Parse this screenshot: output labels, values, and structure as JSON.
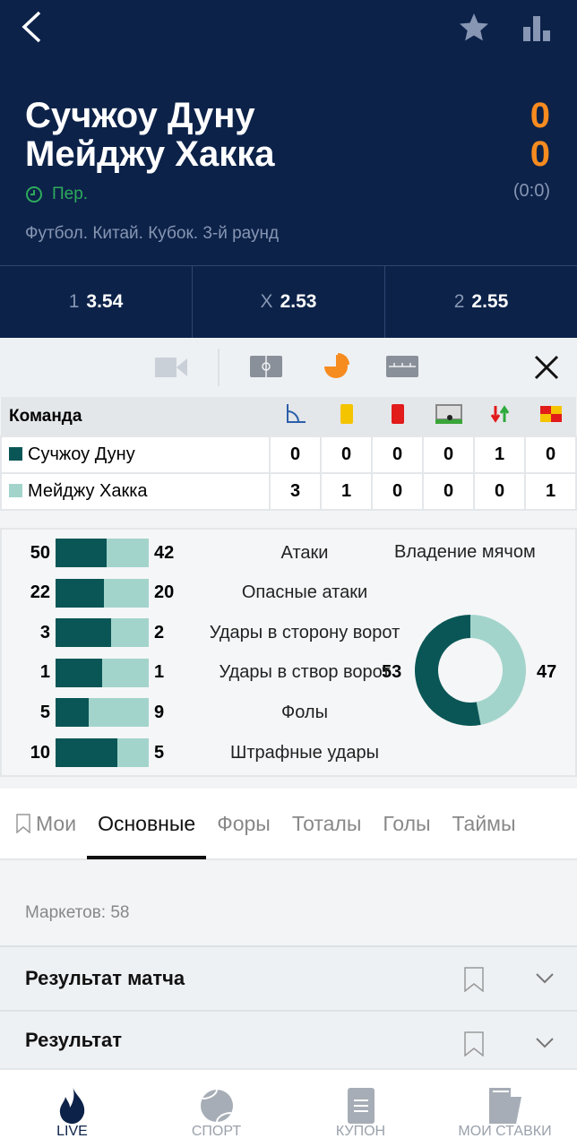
{
  "header": {
    "team1": "Сучжоу Дуну",
    "team2": "Мейджу Хакка",
    "score1": "0",
    "score2": "0",
    "half_score": "(0:0)",
    "period": "Пер.",
    "league": "Футбол. Китай. Кубок. 3-й раунд"
  },
  "odds": [
    {
      "k": "1",
      "v": "3.54"
    },
    {
      "k": "X",
      "v": "2.53"
    },
    {
      "k": "2",
      "v": "2.55"
    }
  ],
  "toolbar": {
    "icons": [
      "video-icon",
      "field-icon",
      "pie-chart-icon",
      "timeline-icon",
      "close-icon"
    ],
    "active": "pie-chart-icon",
    "accent": "#f68b1f"
  },
  "table": {
    "header": "Команда",
    "columns": [
      "corner-icon",
      "yellow-card-icon",
      "red-card-icon",
      "penalty-icon",
      "substitution-icon",
      "offside-flag-icon"
    ],
    "rows": [
      {
        "team": "Сучжоу Дуну",
        "color": "#0a5656",
        "values": [
          "0",
          "0",
          "0",
          "0",
          "1",
          "0"
        ]
      },
      {
        "team": "Мейджу Хакка",
        "color": "#a3d4cc",
        "values": [
          "3",
          "1",
          "0",
          "0",
          "0",
          "1"
        ]
      }
    ]
  },
  "stats": {
    "rows": [
      {
        "label": "Атаки",
        "a": 50,
        "b": 42
      },
      {
        "label": "Опасные атаки",
        "a": 22,
        "b": 20
      },
      {
        "label": "Удары в сторону ворот",
        "a": 3,
        "b": 2
      },
      {
        "label": "Удары в створ ворот",
        "a": 1,
        "b": 1
      },
      {
        "label": "Фолы",
        "a": 5,
        "b": 9
      },
      {
        "label": "Штрафные удары",
        "a": 10,
        "b": 5
      }
    ],
    "possession": {
      "title": "Владение мячом",
      "a": 53,
      "b": 47
    }
  },
  "tabs": [
    {
      "label": "Мои"
    },
    {
      "label": "Основные"
    },
    {
      "label": "Форы"
    },
    {
      "label": "Тоталы"
    },
    {
      "label": "Голы"
    },
    {
      "label": "Таймы"
    }
  ],
  "active_tab": "Основные",
  "markets": {
    "count_label": "Маркетов: 58",
    "items": [
      {
        "title": "Результат матча"
      },
      {
        "title": "Результат"
      }
    ]
  },
  "nav": [
    {
      "label": "LIVE"
    },
    {
      "label": "СПОРТ"
    },
    {
      "label": "КУПОН"
    },
    {
      "label": "МОИ СТАВКИ"
    }
  ]
}
